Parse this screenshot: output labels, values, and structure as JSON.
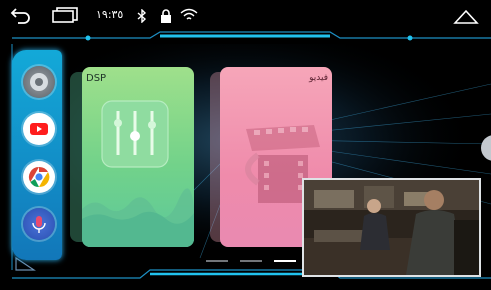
{
  "status_bar": {
    "clock": "١٩:٣٥",
    "icons": [
      "back-icon",
      "recents-icon",
      "bluetooth-icon",
      "lock-icon",
      "wifi-icon",
      "home-icon"
    ]
  },
  "dock": {
    "apps": [
      {
        "name": "media-player",
        "icon": "media-player-icon"
      },
      {
        "name": "youtube",
        "icon": "youtube-icon"
      },
      {
        "name": "chrome",
        "icon": "chrome-icon"
      },
      {
        "name": "voice-assistant",
        "icon": "microphone-icon"
      }
    ]
  },
  "cards": {
    "dsp": {
      "title": "DSP",
      "icon": "equalizer-icon"
    },
    "video": {
      "title": "فيديو",
      "icon": "film-icon"
    }
  },
  "pager": {
    "pages": 3,
    "current": 3
  },
  "colors": {
    "accent": "#19b4e6",
    "dsp_card": "#7ad58c",
    "video_card": "#ef8fae"
  }
}
